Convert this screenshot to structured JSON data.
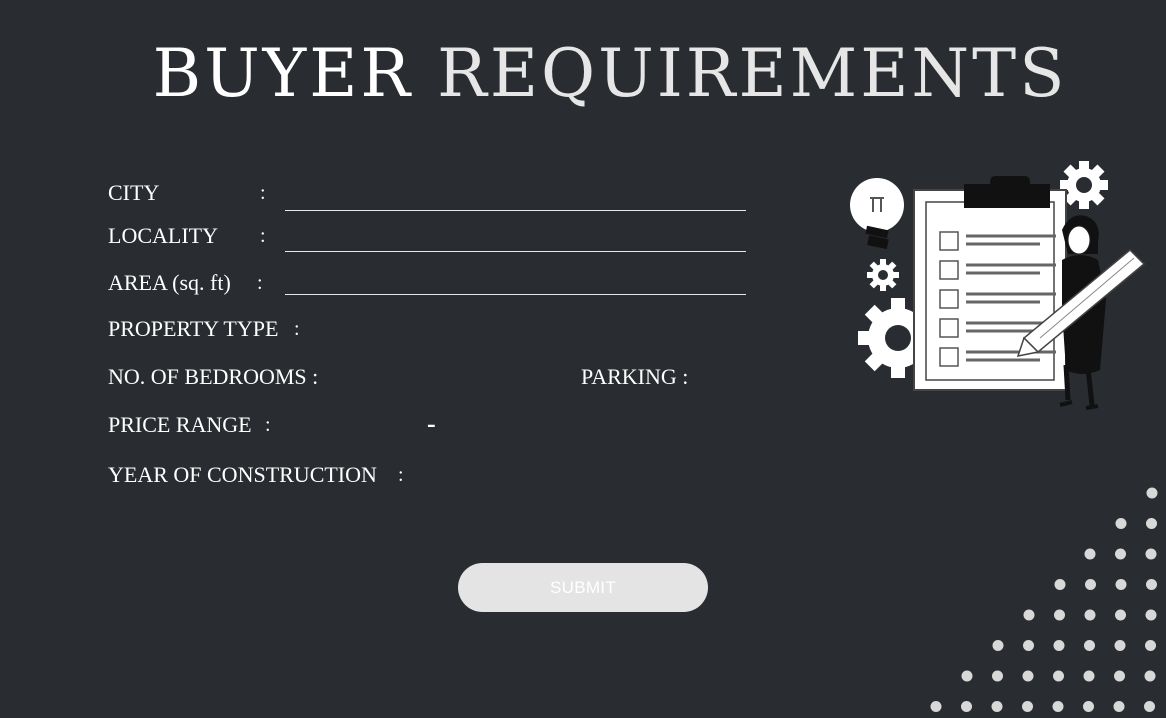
{
  "title": {
    "word1": "BUYER",
    "word2": "REQUIREMENTS"
  },
  "form": {
    "city_label": "CITY",
    "locality_label": "LOCALITY",
    "area_label": "AREA (sq. ft)",
    "property_type_label": "PROPERTY TYPE",
    "bedrooms_label": "NO. OF BEDROOMS :",
    "parking_label": "PARKING :",
    "price_range_label": "PRICE RANGE",
    "price_separator": "-",
    "year_label": "YEAR OF CONSTRUCTION",
    "colon": ":",
    "city_value": "",
    "locality_value": "",
    "area_value": ""
  },
  "submit_label": "SUBMIT",
  "icons": {
    "illustration": "woman-with-checklist-clipboard-pencil",
    "bulb": "lightbulb-icon",
    "gears": "gear-icon"
  },
  "colors": {
    "background": "#292d31",
    "text": "#ffffff",
    "button": "#e4e4e4",
    "dots": "#d8d8d8"
  }
}
